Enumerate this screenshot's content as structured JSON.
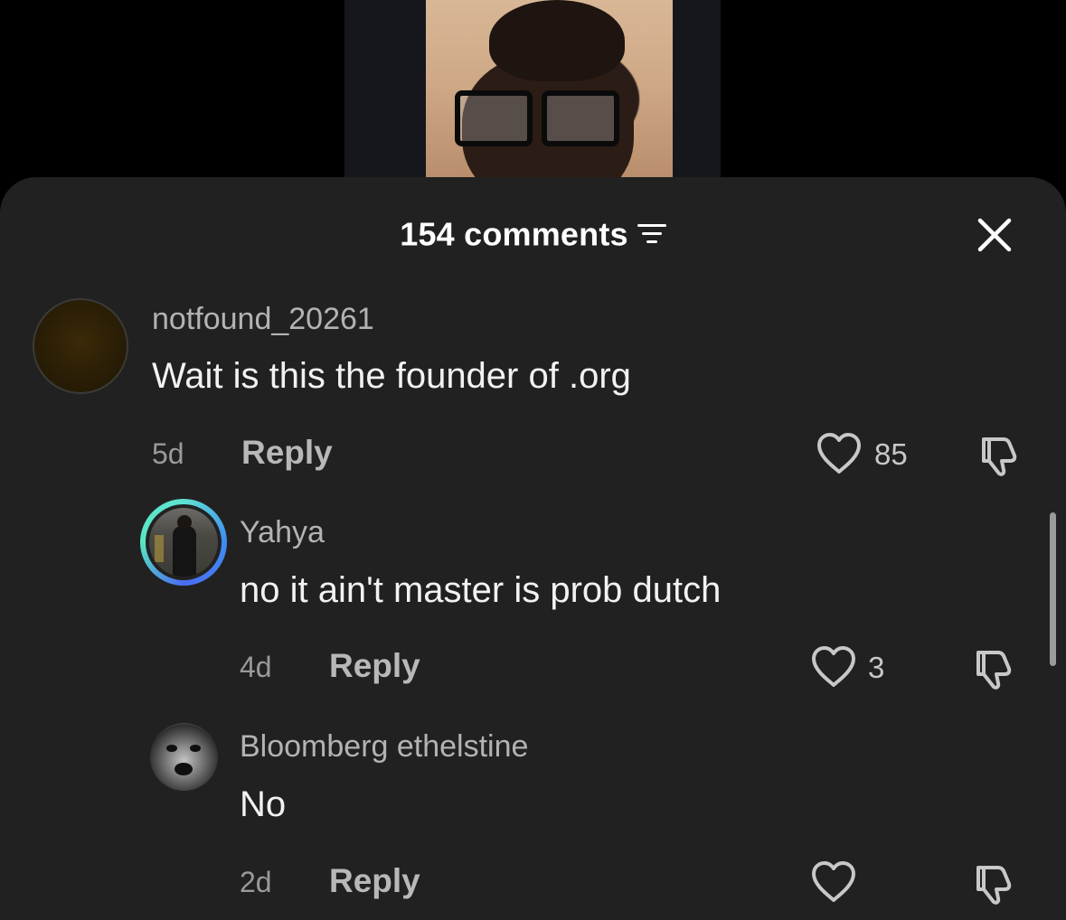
{
  "header": {
    "comments_count_label": "154 comments",
    "sort_icon": "sort-lines-icon",
    "close_icon": "close-x-icon"
  },
  "comments": [
    {
      "username": "notfound_20261",
      "text": "Wait is this the founder of .org",
      "time": "5d",
      "reply_label": "Reply",
      "like_count": "85"
    },
    {
      "username": "Yahya",
      "text": "no it ain't master is prob dutch",
      "time": "4d",
      "reply_label": "Reply",
      "like_count": "3"
    },
    {
      "username": "Bloomberg ethelstine",
      "text": "No",
      "time": "2d",
      "reply_label": "Reply",
      "like_count": ""
    }
  ],
  "icons": {
    "like": "heart-outline-icon",
    "dislike": "thumbs-down-outline-icon"
  },
  "colors": {
    "sheet_background": "#212121",
    "primary_text": "#f2f2f2",
    "secondary_text": "#b3b3b3",
    "avatar_ring": "#4fd6cf"
  }
}
